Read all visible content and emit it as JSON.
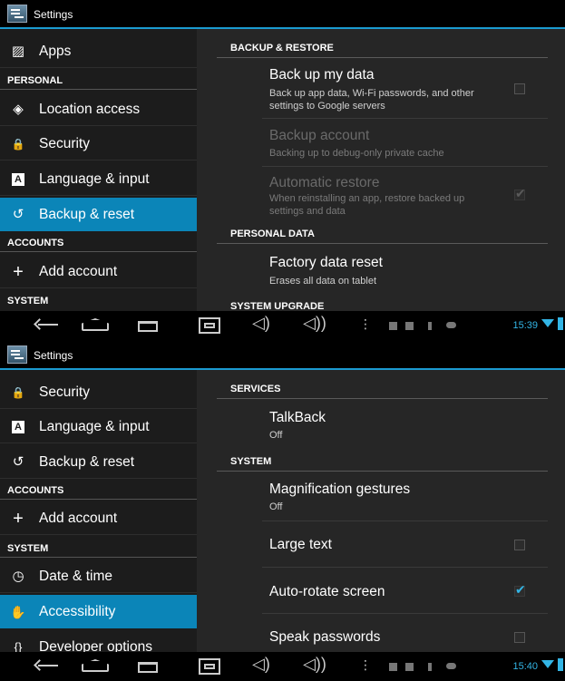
{
  "screens": [
    {
      "title": "Settings",
      "nav_items": [
        {
          "label": "Apps",
          "icon": "apps-icon",
          "glyph": "▨"
        },
        {
          "header": "PERSONAL"
        },
        {
          "label": "Location access",
          "icon": "location-icon",
          "glyph": "◈"
        },
        {
          "label": "Security",
          "icon": "lock-icon",
          "glyph": "🔒"
        },
        {
          "label": "Language & input",
          "icon": "keyboard-icon",
          "glyph": "A"
        },
        {
          "label": "Backup & reset",
          "icon": "backup-icon",
          "glyph": "↺",
          "selected": true
        },
        {
          "header": "ACCOUNTS"
        },
        {
          "label": "Add account",
          "icon": "add-icon",
          "glyph": "+"
        },
        {
          "header": "SYSTEM"
        }
      ],
      "content": [
        {
          "header": "BACKUP & RESTORE"
        },
        {
          "title": "Back up my data",
          "summary": "Back up app data, Wi-Fi passwords, and other settings to Google servers",
          "checkbox": false
        },
        {
          "title": "Backup account",
          "summary": "Backing up to debug-only private cache",
          "disabled": true
        },
        {
          "title": "Automatic restore",
          "summary": "When reinstalling an app, restore backed up settings and data",
          "checkbox": true,
          "disabled": true
        },
        {
          "header": "PERSONAL DATA"
        },
        {
          "title": "Factory data reset",
          "summary": "Erases all data on tablet"
        },
        {
          "header": "SYSTEM UPGRADE"
        }
      ],
      "clock": "15:39"
    },
    {
      "title": "Settings",
      "nav_items": [
        {
          "label": "Security",
          "icon": "lock-icon",
          "glyph": "🔒"
        },
        {
          "label": "Language & input",
          "icon": "keyboard-icon",
          "glyph": "A"
        },
        {
          "label": "Backup & reset",
          "icon": "backup-icon",
          "glyph": "↺"
        },
        {
          "header": "ACCOUNTS"
        },
        {
          "label": "Add account",
          "icon": "add-icon",
          "glyph": "+"
        },
        {
          "header": "SYSTEM"
        },
        {
          "label": "Date & time",
          "icon": "clock-icon",
          "glyph": "◷"
        },
        {
          "label": "Accessibility",
          "icon": "hand-icon",
          "glyph": "✋",
          "selected": true
        },
        {
          "label": "Developer options",
          "icon": "braces-icon",
          "glyph": "{}"
        }
      ],
      "content": [
        {
          "header": "SERVICES"
        },
        {
          "title": "TalkBack",
          "summary": "Off"
        },
        {
          "header": "SYSTEM"
        },
        {
          "title": "Magnification gestures",
          "summary": "Off"
        },
        {
          "title": "Large text",
          "checkbox": false
        },
        {
          "title": "Auto-rotate screen",
          "checkbox": true
        },
        {
          "title": "Speak passwords",
          "checkbox": false
        }
      ],
      "clock": "15:40"
    }
  ],
  "colors": {
    "accent": "#0b85b8",
    "holo_blue": "#33b5e5",
    "left_bg": "#1c1c1c",
    "right_bg": "#262626"
  }
}
